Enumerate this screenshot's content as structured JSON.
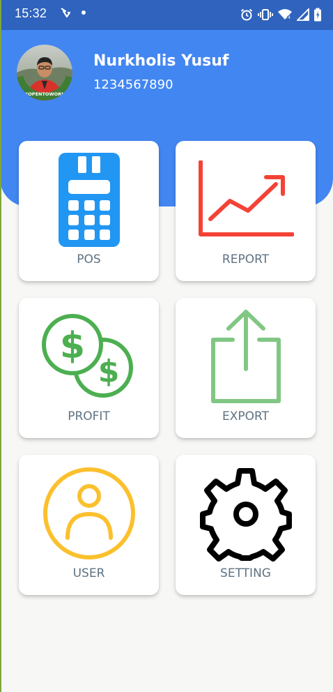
{
  "status_bar": {
    "time": "15:32",
    "left_icons": [
      "mobile-data-arrows-icon",
      "notification-dot-icon"
    ],
    "right_icons": [
      "alarm-icon",
      "vibrate-icon",
      "wifi-icon",
      "signal-icon",
      "battery-icon"
    ]
  },
  "profile": {
    "name": "Nurkholis Yusuf",
    "phone": "1234567890",
    "avatar_badge": "#OPENTOWORK"
  },
  "menu": [
    {
      "label": "POS",
      "icon": "pos-terminal-icon",
      "color": "#2196f3"
    },
    {
      "label": "REPORT",
      "icon": "trending-chart-icon",
      "color": "#f44336"
    },
    {
      "label": "PROFIT",
      "icon": "coins-icon",
      "color": "#4caf50"
    },
    {
      "label": "EXPORT",
      "icon": "share-export-icon",
      "color": "#81c784"
    },
    {
      "label": "USER",
      "icon": "user-icon",
      "color": "#fbc02d"
    },
    {
      "label": "SETTING",
      "icon": "gear-icon",
      "color": "#000000"
    }
  ],
  "colors": {
    "status_bar": "#2f63bd",
    "header": "#4286f2",
    "background": "#f7f7f5",
    "label_text": "#5e7282"
  }
}
